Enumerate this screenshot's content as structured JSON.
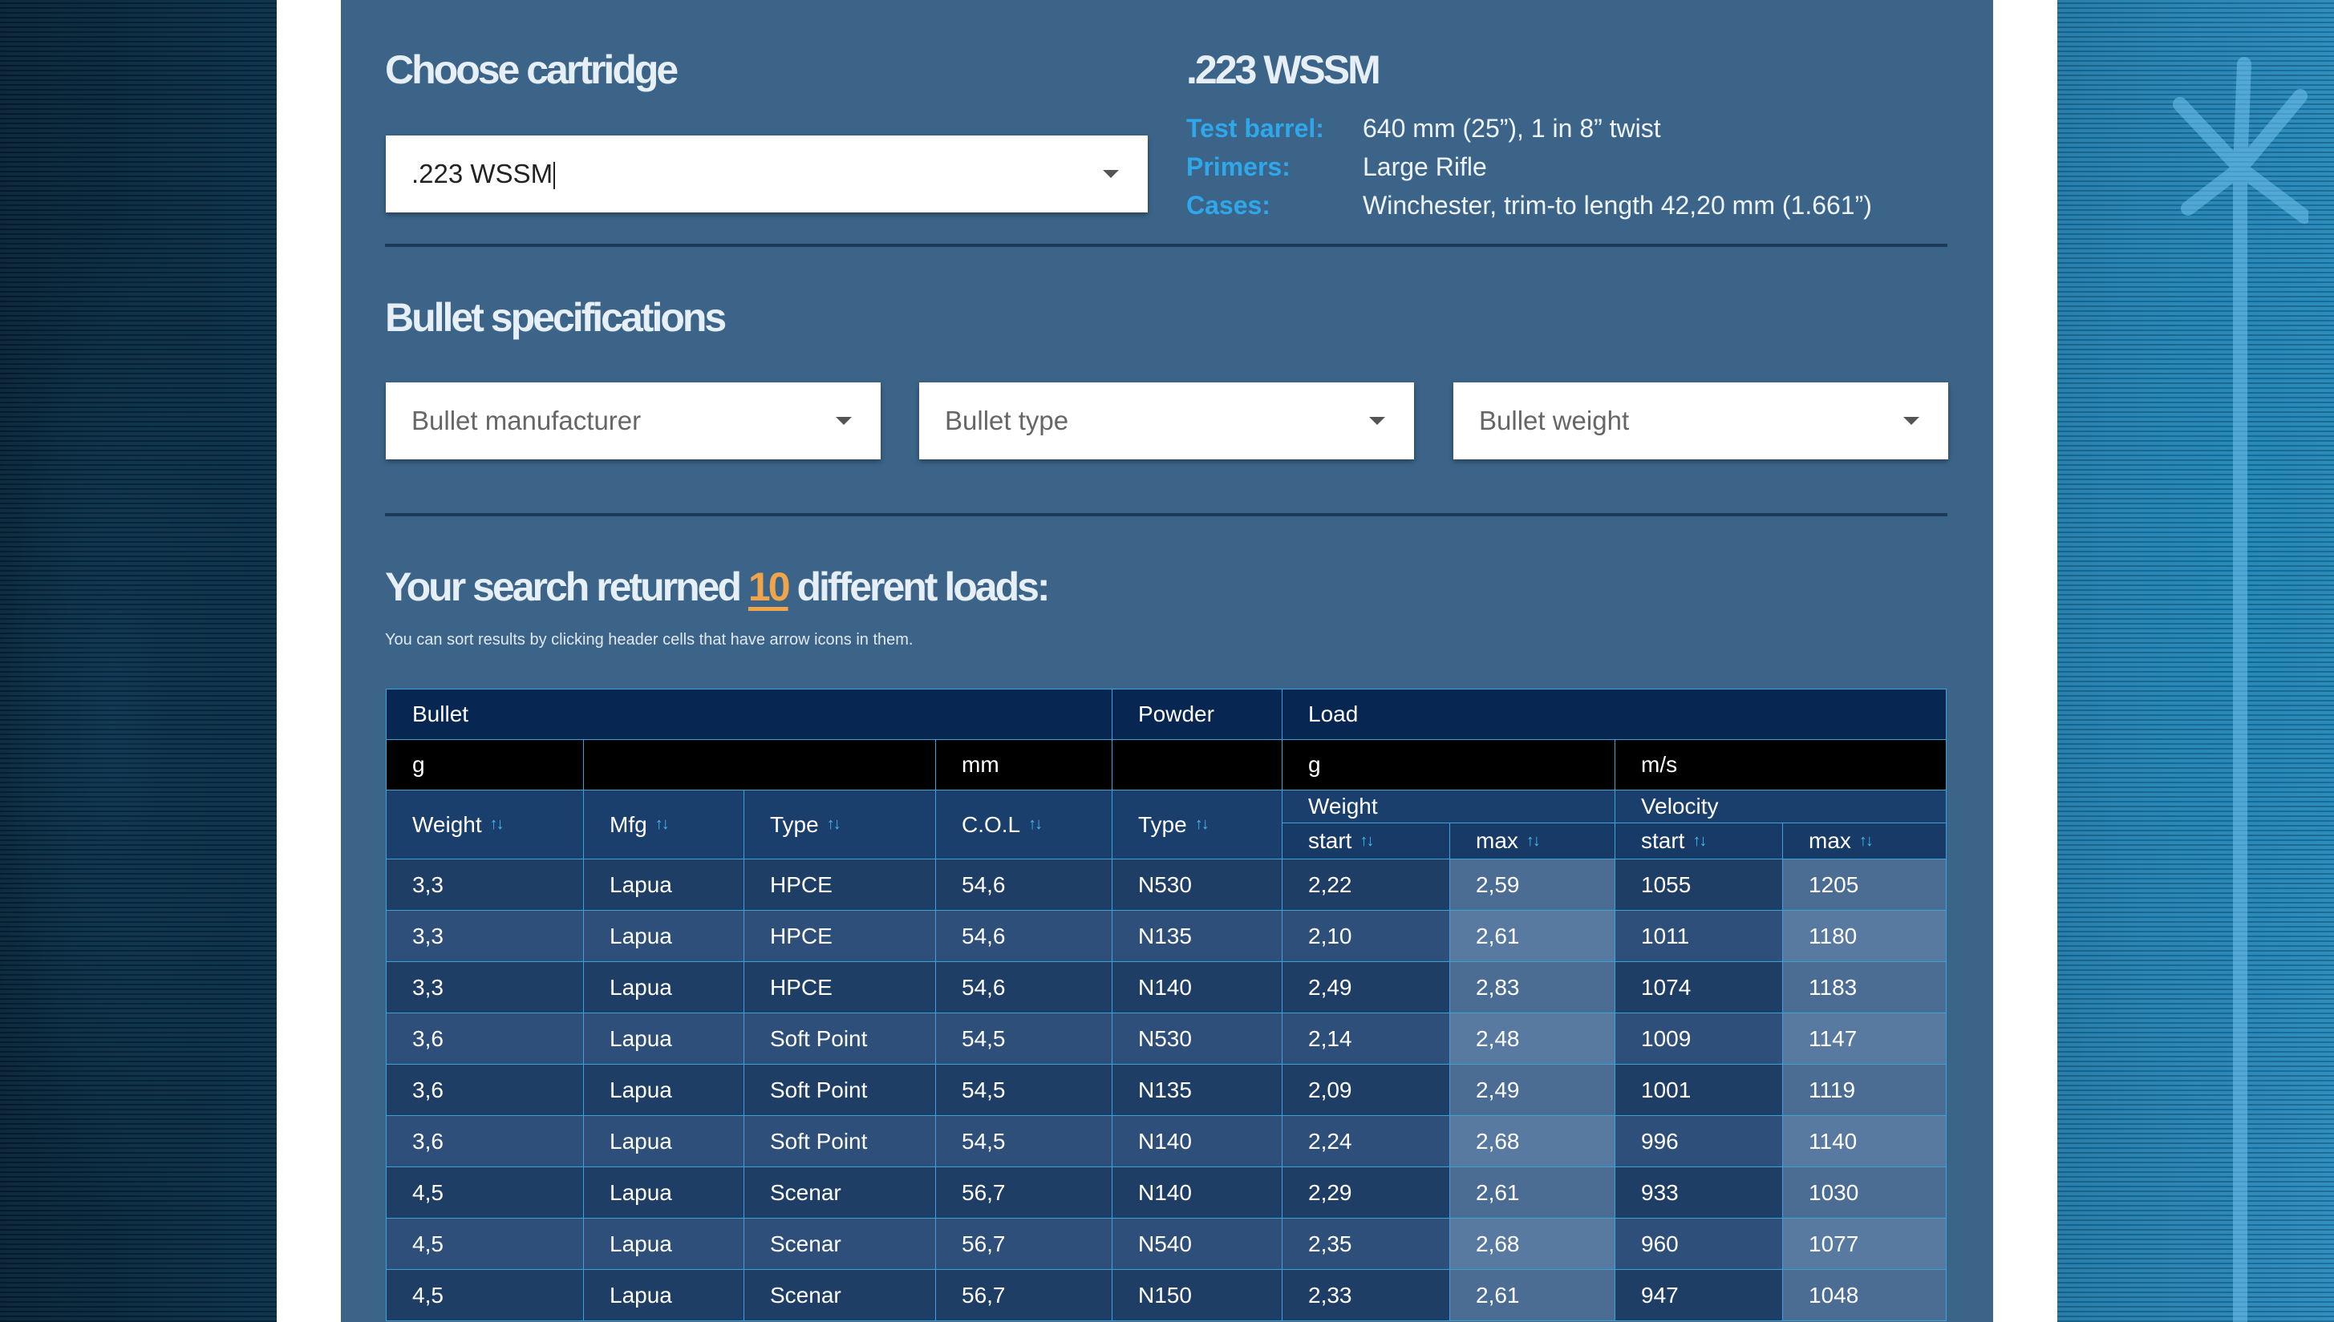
{
  "cartridge_section": {
    "title": "Choose cartridge",
    "selected": ".223 WSSM"
  },
  "cartridge_info": {
    "name": ".223 WSSM",
    "rows": [
      {
        "label": "Test barrel:",
        "value": "640 mm (25”), 1 in 8” twist"
      },
      {
        "label": "Primers:",
        "value": "Large Rifle"
      },
      {
        "label": "Cases:",
        "value": "Winchester, trim-to length 42,20 mm (1.661”)"
      }
    ]
  },
  "bullet_section": {
    "title": "Bullet specifications",
    "manufacturer_placeholder": "Bullet manufacturer",
    "type_placeholder": "Bullet type",
    "weight_placeholder": "Bullet weight"
  },
  "results": {
    "prefix": "Your search returned",
    "count": "10",
    "suffix": "different loads:",
    "hint": "You can sort results by clicking header cells that have arrow icons in them."
  },
  "table": {
    "group_headers": {
      "bullet": "Bullet",
      "powder": "Powder",
      "load": "Load"
    },
    "units": {
      "weight": "g",
      "col": "mm",
      "load_weight": "g",
      "velocity": "m/s"
    },
    "columns": {
      "weight": "Weight",
      "mfg": "Mfg",
      "type": "Type",
      "col": "C.O.L",
      "powder_type": "Type",
      "load_weight": "Weight",
      "velocity": "Velocity",
      "start": "start",
      "max": "max"
    },
    "sort_arrows": "↑↓",
    "rows": [
      [
        "3,3",
        "Lapua",
        "HPCE",
        "54,6",
        "N530",
        "2,22",
        "2,59",
        "1055",
        "1205"
      ],
      [
        "3,3",
        "Lapua",
        "HPCE",
        "54,6",
        "N135",
        "2,10",
        "2,61",
        "1011",
        "1180"
      ],
      [
        "3,3",
        "Lapua",
        "HPCE",
        "54,6",
        "N140",
        "2,49",
        "2,83",
        "1074",
        "1183"
      ],
      [
        "3,6",
        "Lapua",
        "Soft Point",
        "54,5",
        "N530",
        "2,14",
        "2,48",
        "1009",
        "1147"
      ],
      [
        "3,6",
        "Lapua",
        "Soft Point",
        "54,5",
        "N135",
        "2,09",
        "2,49",
        "1001",
        "1119"
      ],
      [
        "3,6",
        "Lapua",
        "Soft Point",
        "54,5",
        "N140",
        "2,24",
        "2,68",
        "996",
        "1140"
      ],
      [
        "4,5",
        "Lapua",
        "Scenar",
        "56,7",
        "N140",
        "2,29",
        "2,61",
        "933",
        "1030"
      ],
      [
        "4,5",
        "Lapua",
        "Scenar",
        "56,7",
        "N540",
        "2,35",
        "2,68",
        "960",
        "1077"
      ],
      [
        "4,5",
        "Lapua",
        "Scenar",
        "56,7",
        "N150",
        "2,33",
        "2,61",
        "947",
        "1048"
      ]
    ]
  }
}
